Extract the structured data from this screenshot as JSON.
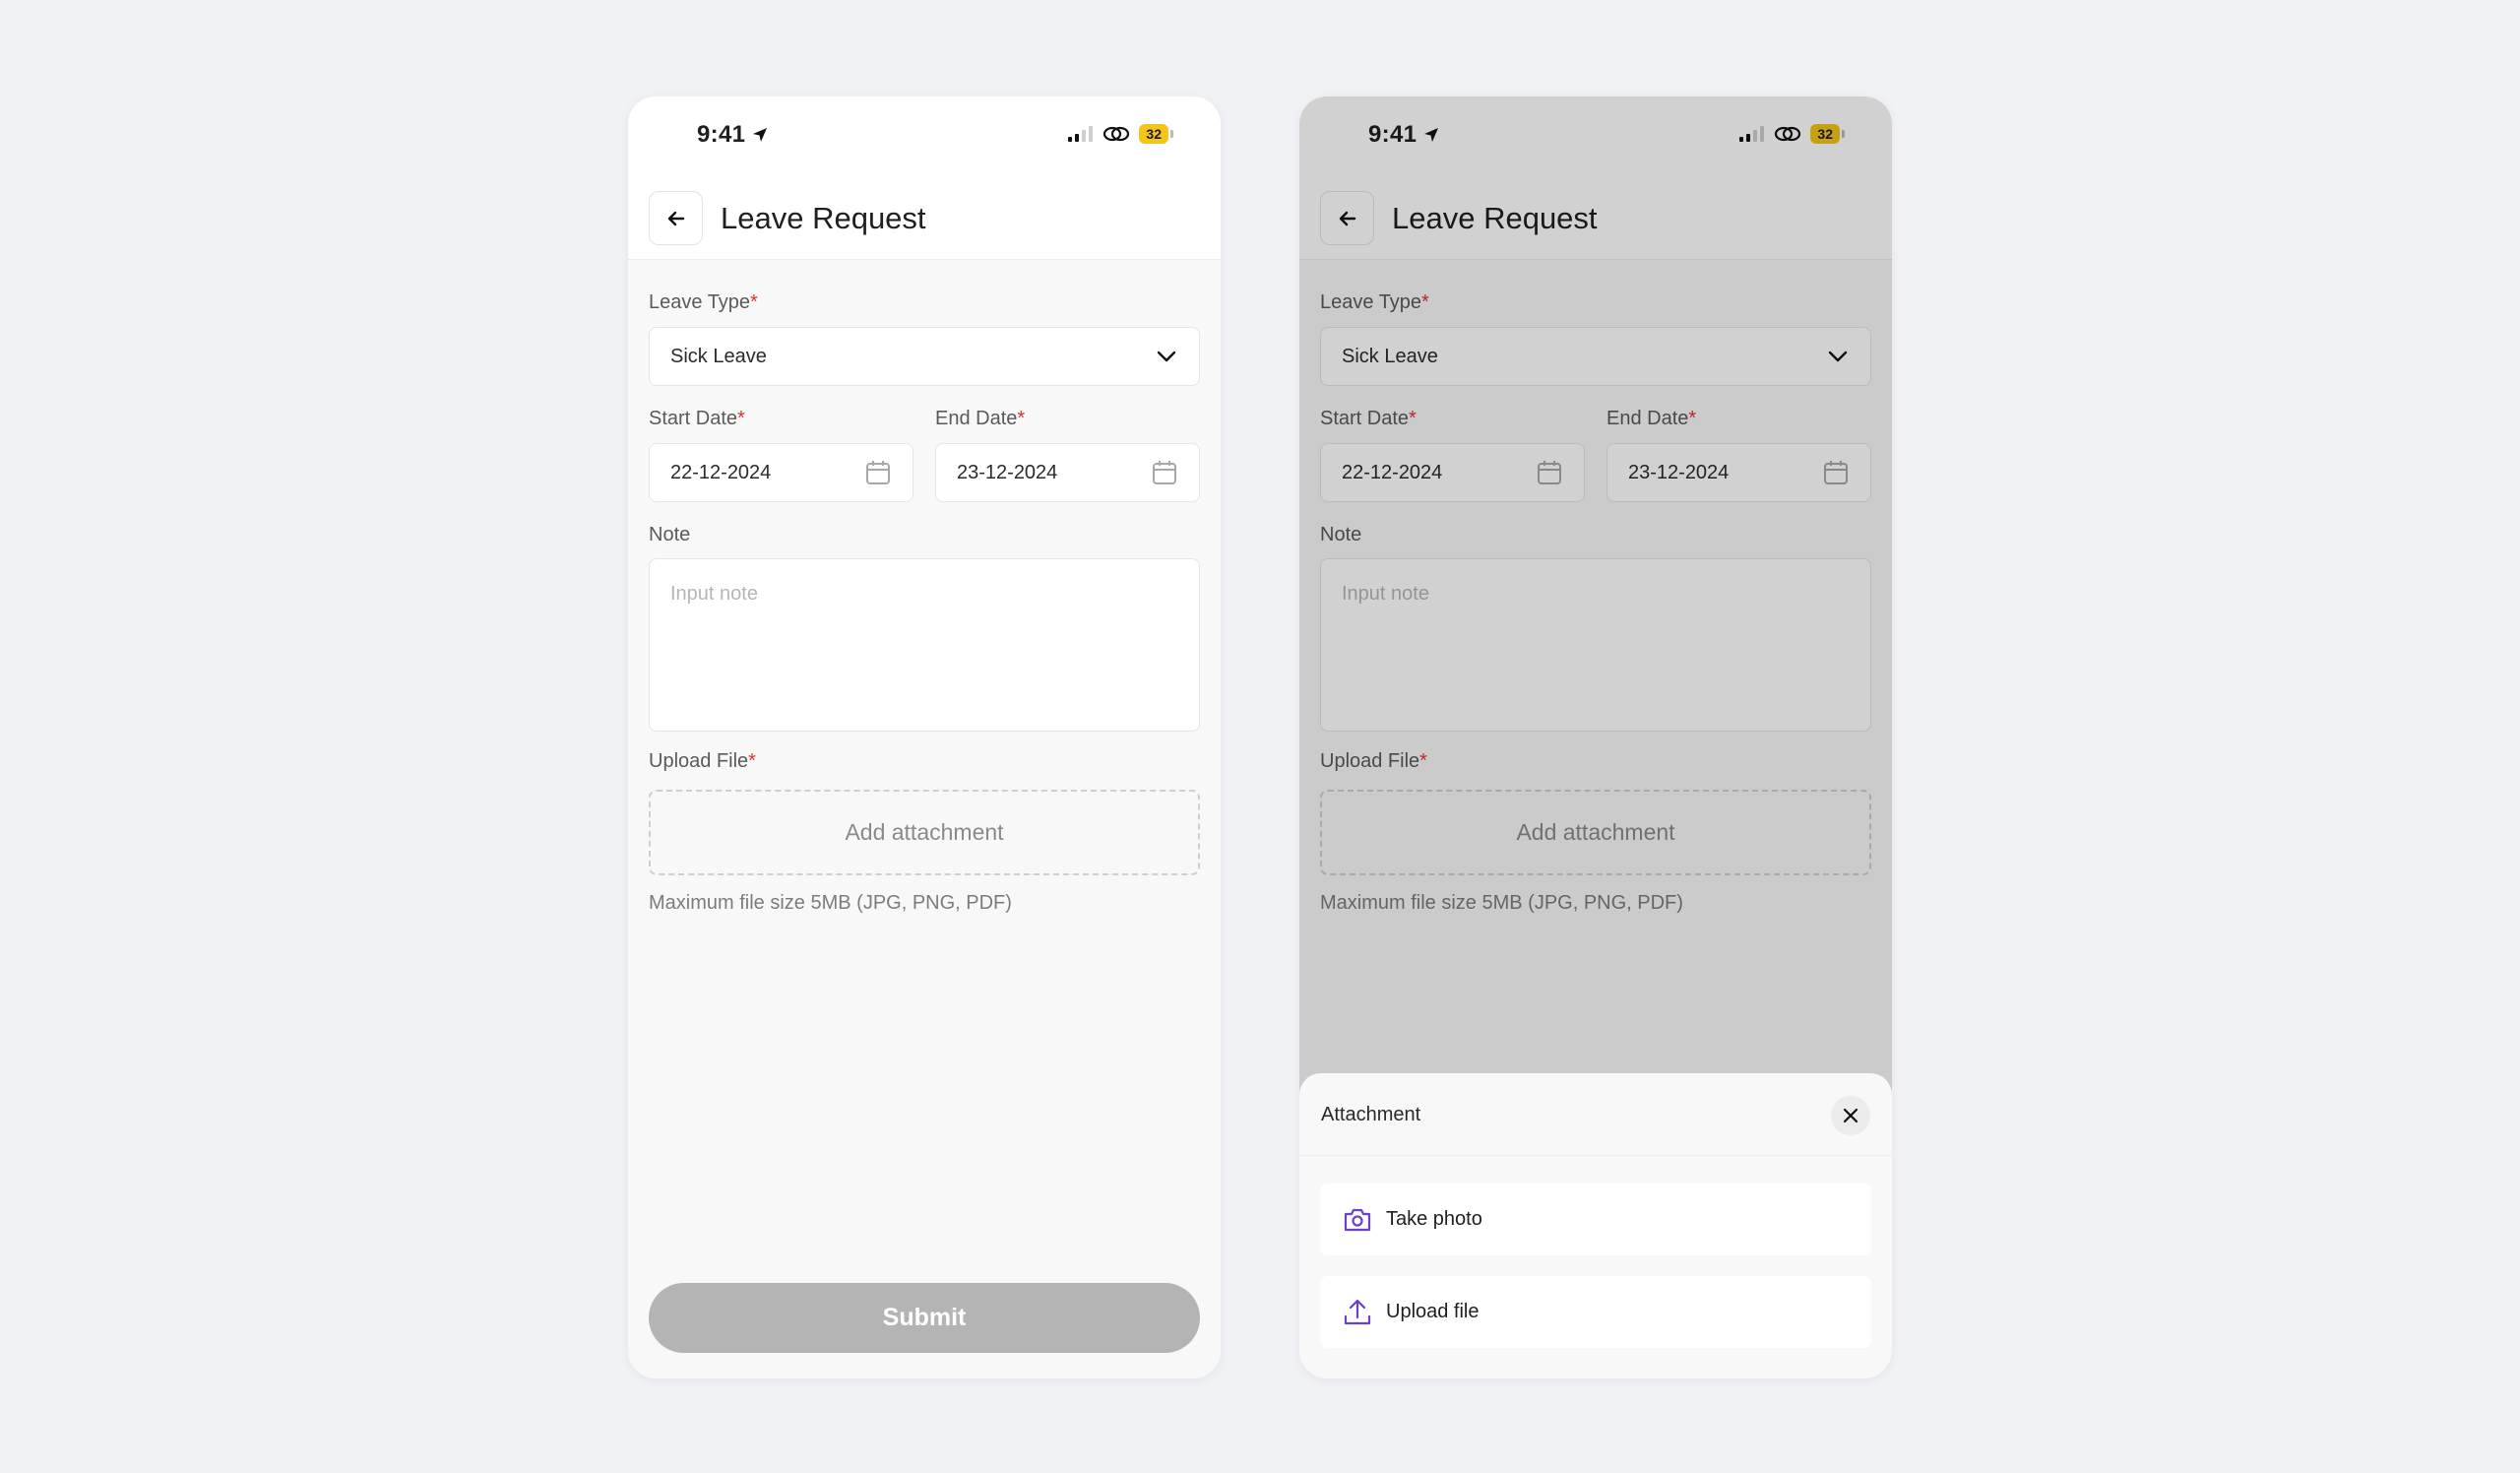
{
  "status_bar": {
    "time": "9:41",
    "battery": "32"
  },
  "header": {
    "title": "Leave Request"
  },
  "form": {
    "leave_type": {
      "label": "Leave Type",
      "required": "*",
      "value": "Sick Leave"
    },
    "start_date": {
      "label": "Start Date",
      "required": "*",
      "value": "22-12-2024"
    },
    "end_date": {
      "label": "End Date",
      "required": "*",
      "value": "23-12-2024"
    },
    "note": {
      "label": "Note",
      "placeholder": "Input note"
    },
    "upload": {
      "label": "Upload File",
      "required": "*",
      "button": "Add attachment",
      "hint": "Maximum file size 5MB (JPG, PNG, PDF)"
    }
  },
  "submit": {
    "label": "Submit"
  },
  "attachment_sheet": {
    "title": "Attachment",
    "options": [
      {
        "label": "Take photo",
        "icon": "camera-icon"
      },
      {
        "label": "Upload file",
        "icon": "upload-icon"
      }
    ]
  },
  "colors": {
    "required": "#e0312f",
    "accent_icon": "#6b3fd1",
    "submit_disabled": "#b4b4b4",
    "battery": "#f5c518"
  }
}
